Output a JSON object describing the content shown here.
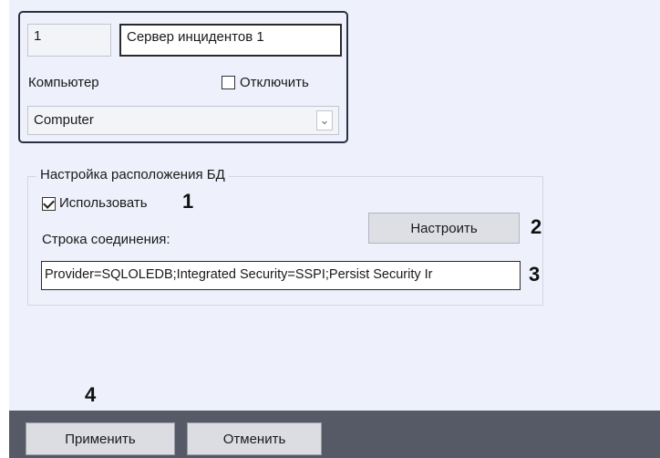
{
  "server": {
    "id_value": "1",
    "name_value": "Сервер инцидентов 1",
    "computer_label": "Компьютер",
    "disable_label": "Отключить",
    "disable_checked": false,
    "computer_select_value": "Computer"
  },
  "db_settings": {
    "group_title": "Настройка расположения БД",
    "use_label": "Использовать",
    "use_checked": true,
    "configure_button": "Настроить",
    "connection_label": "Строка соединения:",
    "connection_value": "Provider=SQLOLEDB;Integrated Security=SSPI;Persist Security Ir"
  },
  "callouts": {
    "use": "1",
    "configure": "2",
    "connection": "3",
    "apply": "4"
  },
  "footer": {
    "apply_button": "Применить",
    "cancel_button": "Отменить"
  },
  "colors": {
    "panel_background": "#eef0fb",
    "bottom_bar": "#555a66",
    "group_border": "#2b3245"
  }
}
